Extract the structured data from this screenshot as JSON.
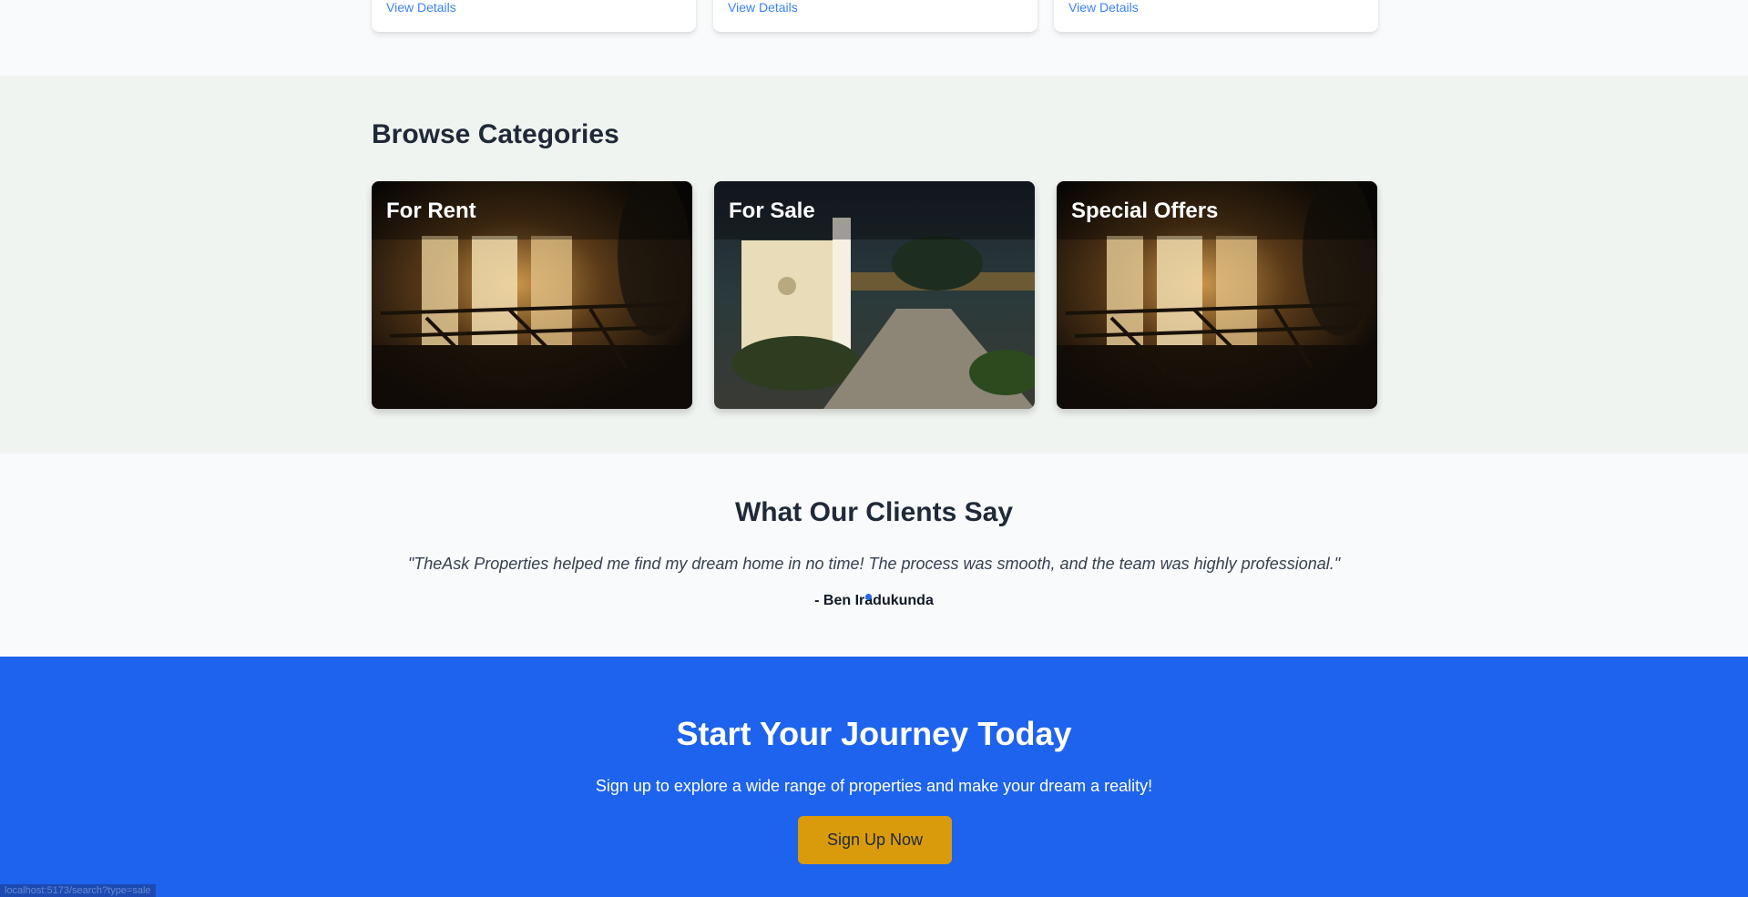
{
  "featured": {
    "cards": [
      {
        "link": "View Details"
      },
      {
        "link": "View Details"
      },
      {
        "link": "View Details"
      }
    ]
  },
  "categories": {
    "title": "Browse Categories",
    "items": [
      {
        "label": "For Rent",
        "scene": "night-porch-photo"
      },
      {
        "label": "For Sale",
        "scene": "night-courtyard-photo"
      },
      {
        "label": "Special Offers",
        "scene": "night-porch-photo"
      }
    ]
  },
  "testimonials": {
    "title": "What Our Clients Say",
    "quote": "\"TheAsk Properties helped me find my dream home in no time! The process was smooth, and the team was highly professional.\"",
    "author": "- Ben Iradukunda"
  },
  "cta": {
    "title": "Start Your Journey Today",
    "subtitle": "Sign up to explore a wide range of properties and make your dream a reality!",
    "button": "Sign Up Now"
  },
  "status_bar": {
    "url": "localhost:5173/search?type=sale"
  },
  "colors": {
    "cta_background": "#1d63ed",
    "button_accent": "#d99a0b",
    "link": "#3b82f6"
  }
}
